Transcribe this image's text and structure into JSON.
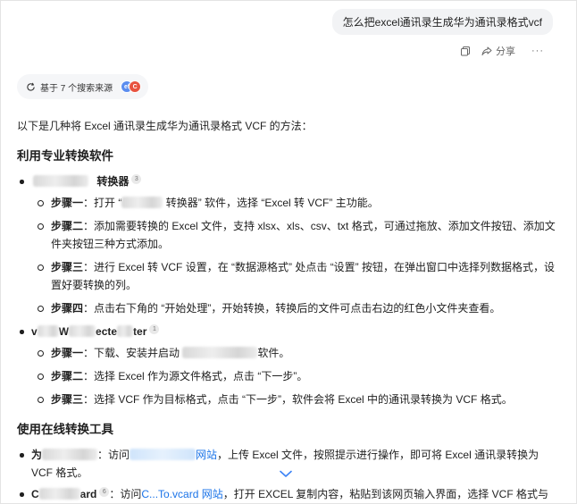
{
  "user_message": "怎么把excel通讯录生成华为通讯录格式vcf",
  "actions": {
    "copy_icon": "copy-icon",
    "share_label": "分享",
    "more_label": "···"
  },
  "sources": {
    "label": "基于 7 个搜索来源",
    "avatars": [
      "ef",
      "C"
    ],
    "colors": {
      "a": "#5b8def",
      "b": "#e8533f"
    }
  },
  "intro": "以下是几种将 Excel 通讯录生成华为通讯录格式 VCF 的方法：",
  "section1": {
    "title": "利用专业转换软件",
    "item1": {
      "name_suffix": "转换器",
      "cite": "3",
      "steps": [
        {
          "label": "步骤一",
          "pre": "：打开 “",
          "post": " 转换器” 软件，选择 “Excel 转 VCF” 主功能。"
        },
        {
          "label": "步骤二",
          "text": "：添加需要转换的 Excel 文件，支持 xlsx、xls、csv、txt 格式，可通过拖放、添加文件按钮、添加文件夹按钮三种方式添加。"
        },
        {
          "label": "步骤三",
          "text": "：进行 Excel 转 VCF 设置，在 “数据源格式” 处点击 “设置” 按钮，在弹出窗口中选择列数据格式，设置好要转换的列。"
        },
        {
          "label": "步骤四",
          "text": "：点击右下角的 “开始处理”，开始转换，转换后的文件可点击右边的红色小文件夹查看。"
        }
      ]
    },
    "item2": {
      "name_prefix": "v",
      "name_mid": "W",
      "name_mid2": "ecte",
      "name_suffix": "ter",
      "cite": "1",
      "steps": [
        {
          "label": "步骤一",
          "pre": "：下载、安装并启动 ",
          "post": "软件。"
        },
        {
          "label": "步骤二",
          "text": "：选择 Excel 作为源文件格式，点击 “下一步”。"
        },
        {
          "label": "步骤三",
          "text": "：选择 VCF 作为目标格式，点击 “下一步”，软件会将 Excel 中的通讯录转换为 VCF 格式。"
        }
      ]
    }
  },
  "section2": {
    "title": "使用在线转换工具",
    "item1": {
      "name_prefix": "为",
      "sep": "：访问",
      "link_suffix": "网站",
      "text": "，上传 Excel 文件，按照提示进行操作，即可将 Excel 通讯录转换为 VCF 格式。"
    },
    "item2": {
      "name_prefix": "C",
      "name_suffix": "ard",
      "cite": "6",
      "sep": "：访问",
      "link_text": "C...To.vcard 网站",
      "text": "，打开 EXCEL 复制内容，粘贴到该网页输入界面，选择 VCF 格式与"
    }
  }
}
